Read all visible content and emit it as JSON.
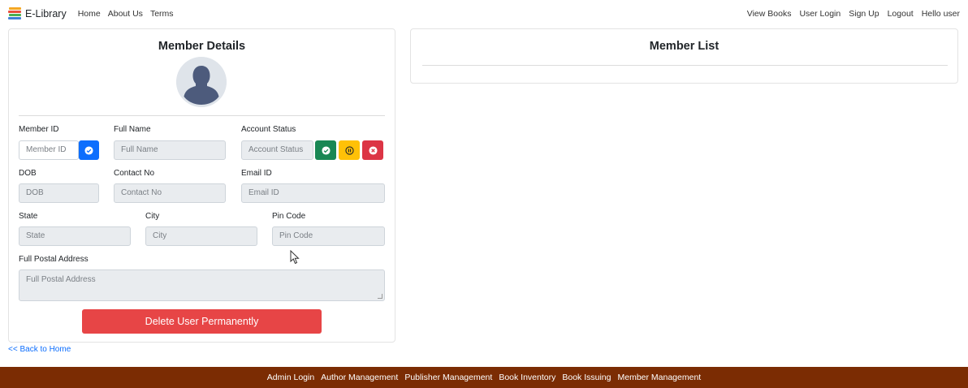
{
  "brand": {
    "name": "E-Library",
    "logo_icon": "books-stack-icon"
  },
  "nav": {
    "left": [
      "Home",
      "About Us",
      "Terms"
    ],
    "right": [
      "View Books",
      "User Login",
      "Sign Up",
      "Logout",
      "Hello user"
    ]
  },
  "member_details": {
    "title": "Member Details",
    "avatar_icon": "user-avatar-icon",
    "fields": {
      "member_id": {
        "label": "Member ID",
        "placeholder": "Member ID"
      },
      "full_name": {
        "label": "Full Name",
        "placeholder": "Full Name"
      },
      "account_status": {
        "label": "Account Status",
        "placeholder": "Account Status"
      },
      "dob": {
        "label": "DOB",
        "placeholder": "DOB"
      },
      "contact_no": {
        "label": "Contact No",
        "placeholder": "Contact No"
      },
      "email_id": {
        "label": "Email ID",
        "placeholder": "Email ID"
      },
      "state": {
        "label": "State",
        "placeholder": "State"
      },
      "city": {
        "label": "City",
        "placeholder": "City"
      },
      "pin_code": {
        "label": "Pin Code",
        "placeholder": "Pin Code"
      },
      "full_postal_address": {
        "label": "Full Postal Address",
        "placeholder": "Full Postal Address"
      }
    },
    "status_buttons": [
      {
        "icon": "check-circle-icon",
        "color": "#198754"
      },
      {
        "icon": "pause-circle-icon",
        "color": "#ffc107"
      },
      {
        "icon": "x-circle-icon",
        "color": "#dc3545"
      }
    ],
    "go_button_icon": "check-circle-icon",
    "delete_button": "Delete User Permanently"
  },
  "member_list": {
    "title": "Member List"
  },
  "back_link": "<< Back to Home",
  "footer": {
    "links": [
      "Admin Login",
      "Author Management",
      "Publisher Management",
      "Book Inventory",
      "Book Issuing",
      "Member Management"
    ]
  },
  "colors": {
    "primary": "#0d6efd",
    "delete": "#e74546",
    "footer_bg": "#7b2c03"
  }
}
